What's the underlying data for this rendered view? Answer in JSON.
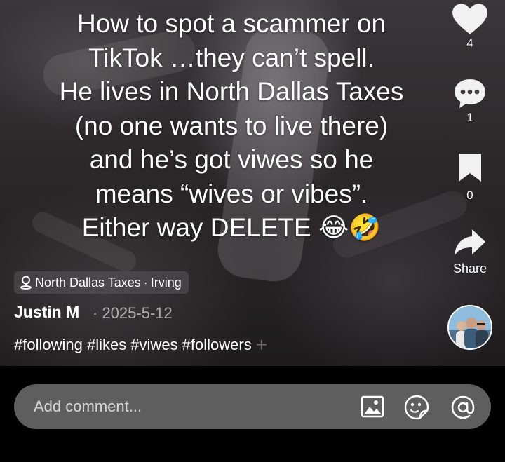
{
  "caption": {
    "lines": [
      "How to spot a scammer on",
      "TikTok …they can’t spell.",
      "He lives in North Dallas Taxes",
      "(no one wants to live there)",
      "and he’s got viwes so he",
      "means “wives or vibes”.",
      "Either way DELETE 😂🤣"
    ]
  },
  "actions": {
    "like_count": "4",
    "comment_count": "1",
    "save_count": "0",
    "share_label": "Share"
  },
  "post": {
    "location": "North Dallas Taxes",
    "location_separator": "·",
    "location_city": "Irving",
    "author": "Justin M",
    "date": "· 2025-5-12",
    "hashtags": "#following #likes #viwes #followers"
  },
  "comment": {
    "placeholder": "Add comment..."
  },
  "icons": {
    "like": "heart-icon",
    "comment": "comment-bubble-icon",
    "save": "bookmark-icon",
    "share": "share-arrow-icon",
    "location": "location-pin-icon",
    "image": "image-icon",
    "emoji": "emoji-sticker-icon",
    "mention": "at-mention-icon"
  }
}
